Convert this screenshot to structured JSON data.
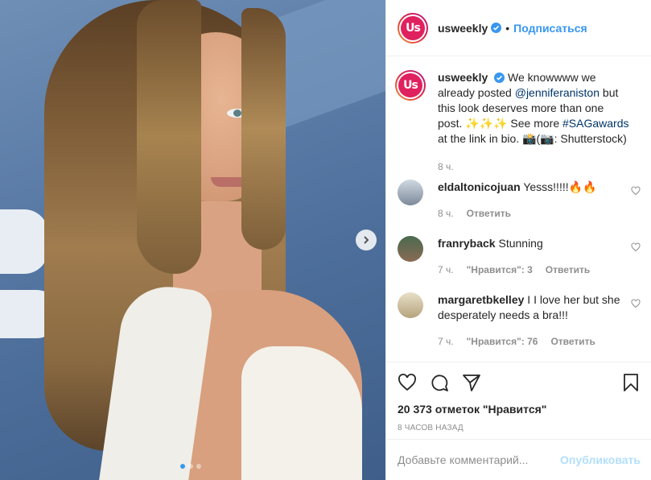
{
  "header": {
    "username": "usweekly",
    "separator": "•",
    "follow_label": "Подписаться",
    "avatar_text": "Us"
  },
  "caption": {
    "username": "usweekly",
    "text_1": "We knowwww we already posted",
    "mention": "@jenniferaniston",
    "text_2": "but this look deserves more than one post. ✨✨✨ See more",
    "hashtag": "#SAGawards",
    "text_3": "at the link in bio. 📸(📷: Shutterstock)",
    "time": "8 ч."
  },
  "comments": [
    {
      "username": "eldaltonicojuan",
      "text": "Yesss!!!!!🔥🔥",
      "time": "8 ч.",
      "likes": "",
      "reply": "Ответить"
    },
    {
      "username": "franryback",
      "text": "Stunning",
      "time": "7 ч.",
      "likes": "\"Нравится\": 3",
      "reply": "Ответить"
    },
    {
      "username": "margaretbkelley",
      "text": "I I love her but she desperately needs a bra!!!",
      "time": "7 ч.",
      "likes": "\"Нравится\": 76",
      "reply": "Ответить"
    }
  ],
  "actions": {
    "likes": "20 373 отметок \"Нравится\"",
    "time": "8 ЧАСОВ НАЗАД"
  },
  "add_comment": {
    "placeholder": "Добавьте комментарий...",
    "post_label": "Опубликовать"
  },
  "colors": {
    "accent": "#3897f0",
    "brand": "#e0215f"
  },
  "carousel": {
    "count": 3,
    "active": 1
  }
}
